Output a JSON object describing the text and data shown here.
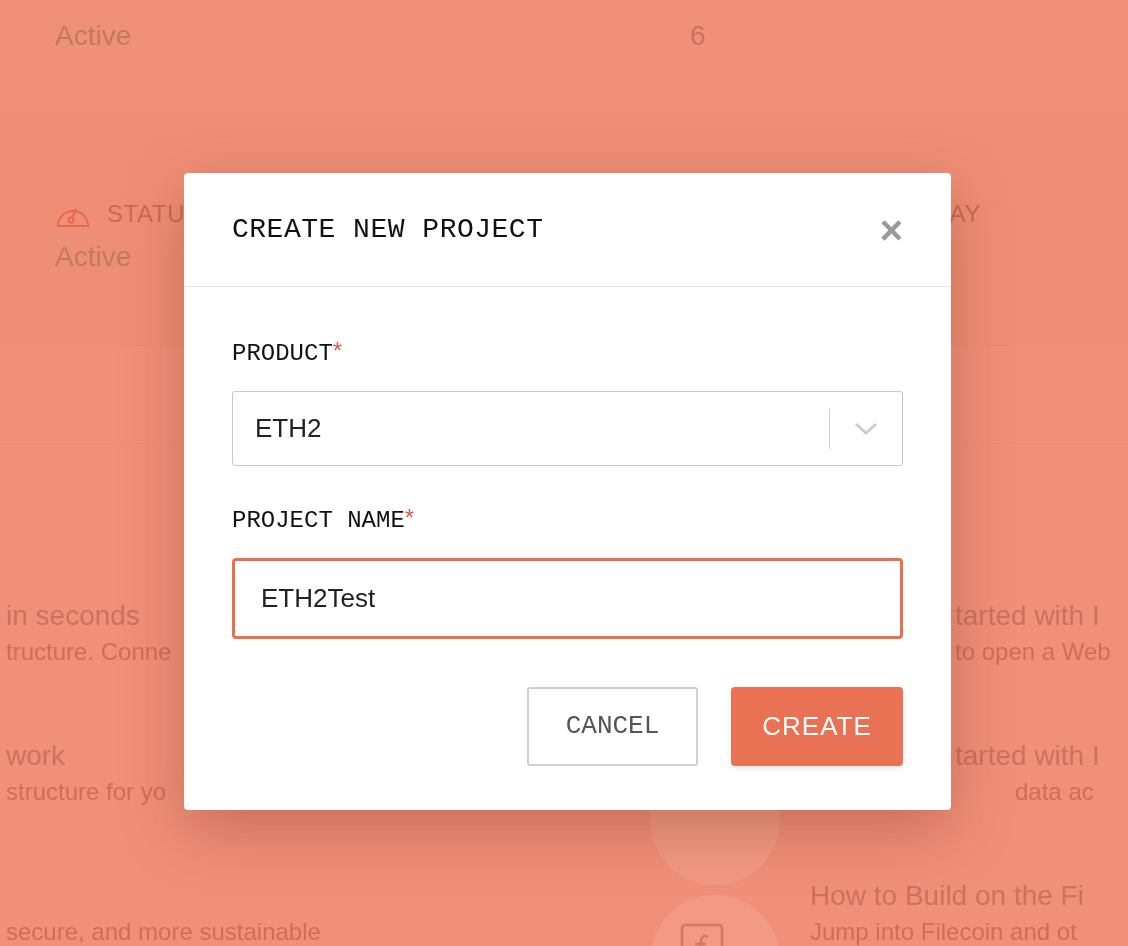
{
  "background": {
    "stats_row": {
      "label": "Active",
      "value": "6"
    },
    "status": {
      "label": "STATU",
      "value": "Active",
      "right_label": "AY"
    },
    "left_items": [
      {
        "title": "in seconds",
        "text": "tructure. Conne"
      },
      {
        "title": "work",
        "text": "structure for yo"
      },
      {
        "text": "secure, and more sustainable"
      }
    ],
    "right_items": [
      {
        "title": "tarted with I",
        "text": "to open a Web"
      },
      {
        "title": "tarted with I",
        "text": "data ac",
        "kind": "plain"
      },
      {
        "title": "How to Build on the Fi",
        "text": "Jump into Filecoin and ot",
        "kind": "book"
      }
    ]
  },
  "dialog": {
    "title": "CREATE NEW PROJECT",
    "close": "×",
    "fields": [
      {
        "kind": "select",
        "label": "PRODUCT",
        "required_mark": "*",
        "value": "ETH2"
      },
      {
        "kind": "text",
        "label": "PROJECT NAME",
        "required_mark": "*",
        "value": "ETH2Test",
        "focused": true
      }
    ],
    "buttons": [
      {
        "label": "CANCEL",
        "primary": false
      },
      {
        "label": "CREATE",
        "primary": true
      }
    ]
  }
}
